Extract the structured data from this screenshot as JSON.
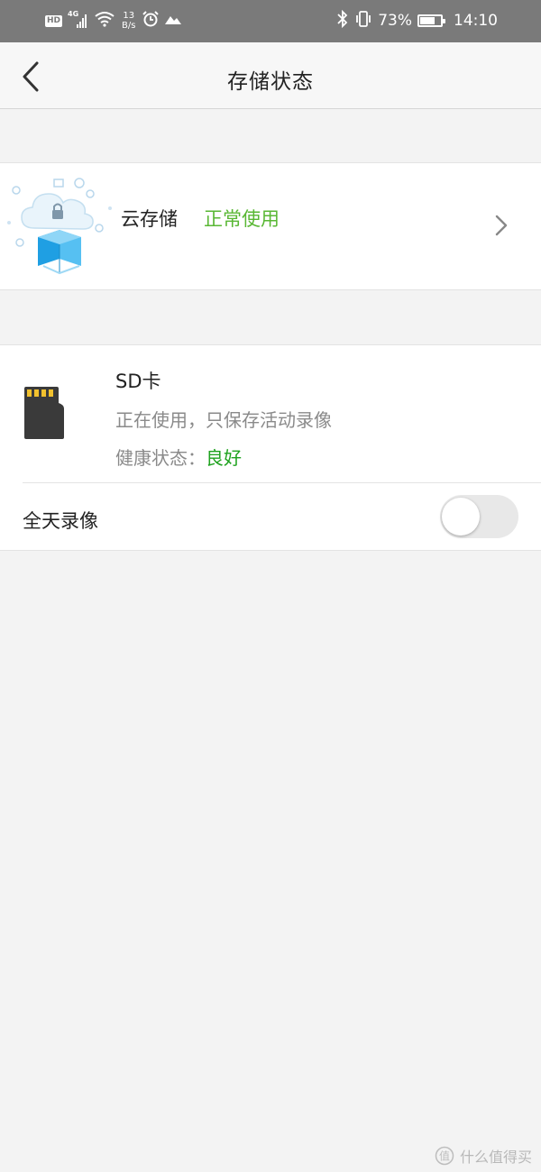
{
  "status_bar": {
    "hd": "HD",
    "network": "4G",
    "net_speed_value": "13",
    "net_speed_unit": "B/s",
    "battery_pct": "73%",
    "battery_level": 0.73,
    "time": "14:10"
  },
  "navbar": {
    "title": "存储状态"
  },
  "cloud": {
    "label": "云存储",
    "status": "正常使用"
  },
  "sd": {
    "title": "SD卡",
    "description": "正在使用，只保存活动录像",
    "health_label": "健康状态：",
    "health_value": "良好"
  },
  "all_day": {
    "label": "全天录像",
    "enabled": false
  },
  "watermark": {
    "text": "什么值得买"
  },
  "colors": {
    "status_ok": "#59b734",
    "health_ok": "#1fa21f",
    "statusbar_bg": "#7a7a7a"
  }
}
